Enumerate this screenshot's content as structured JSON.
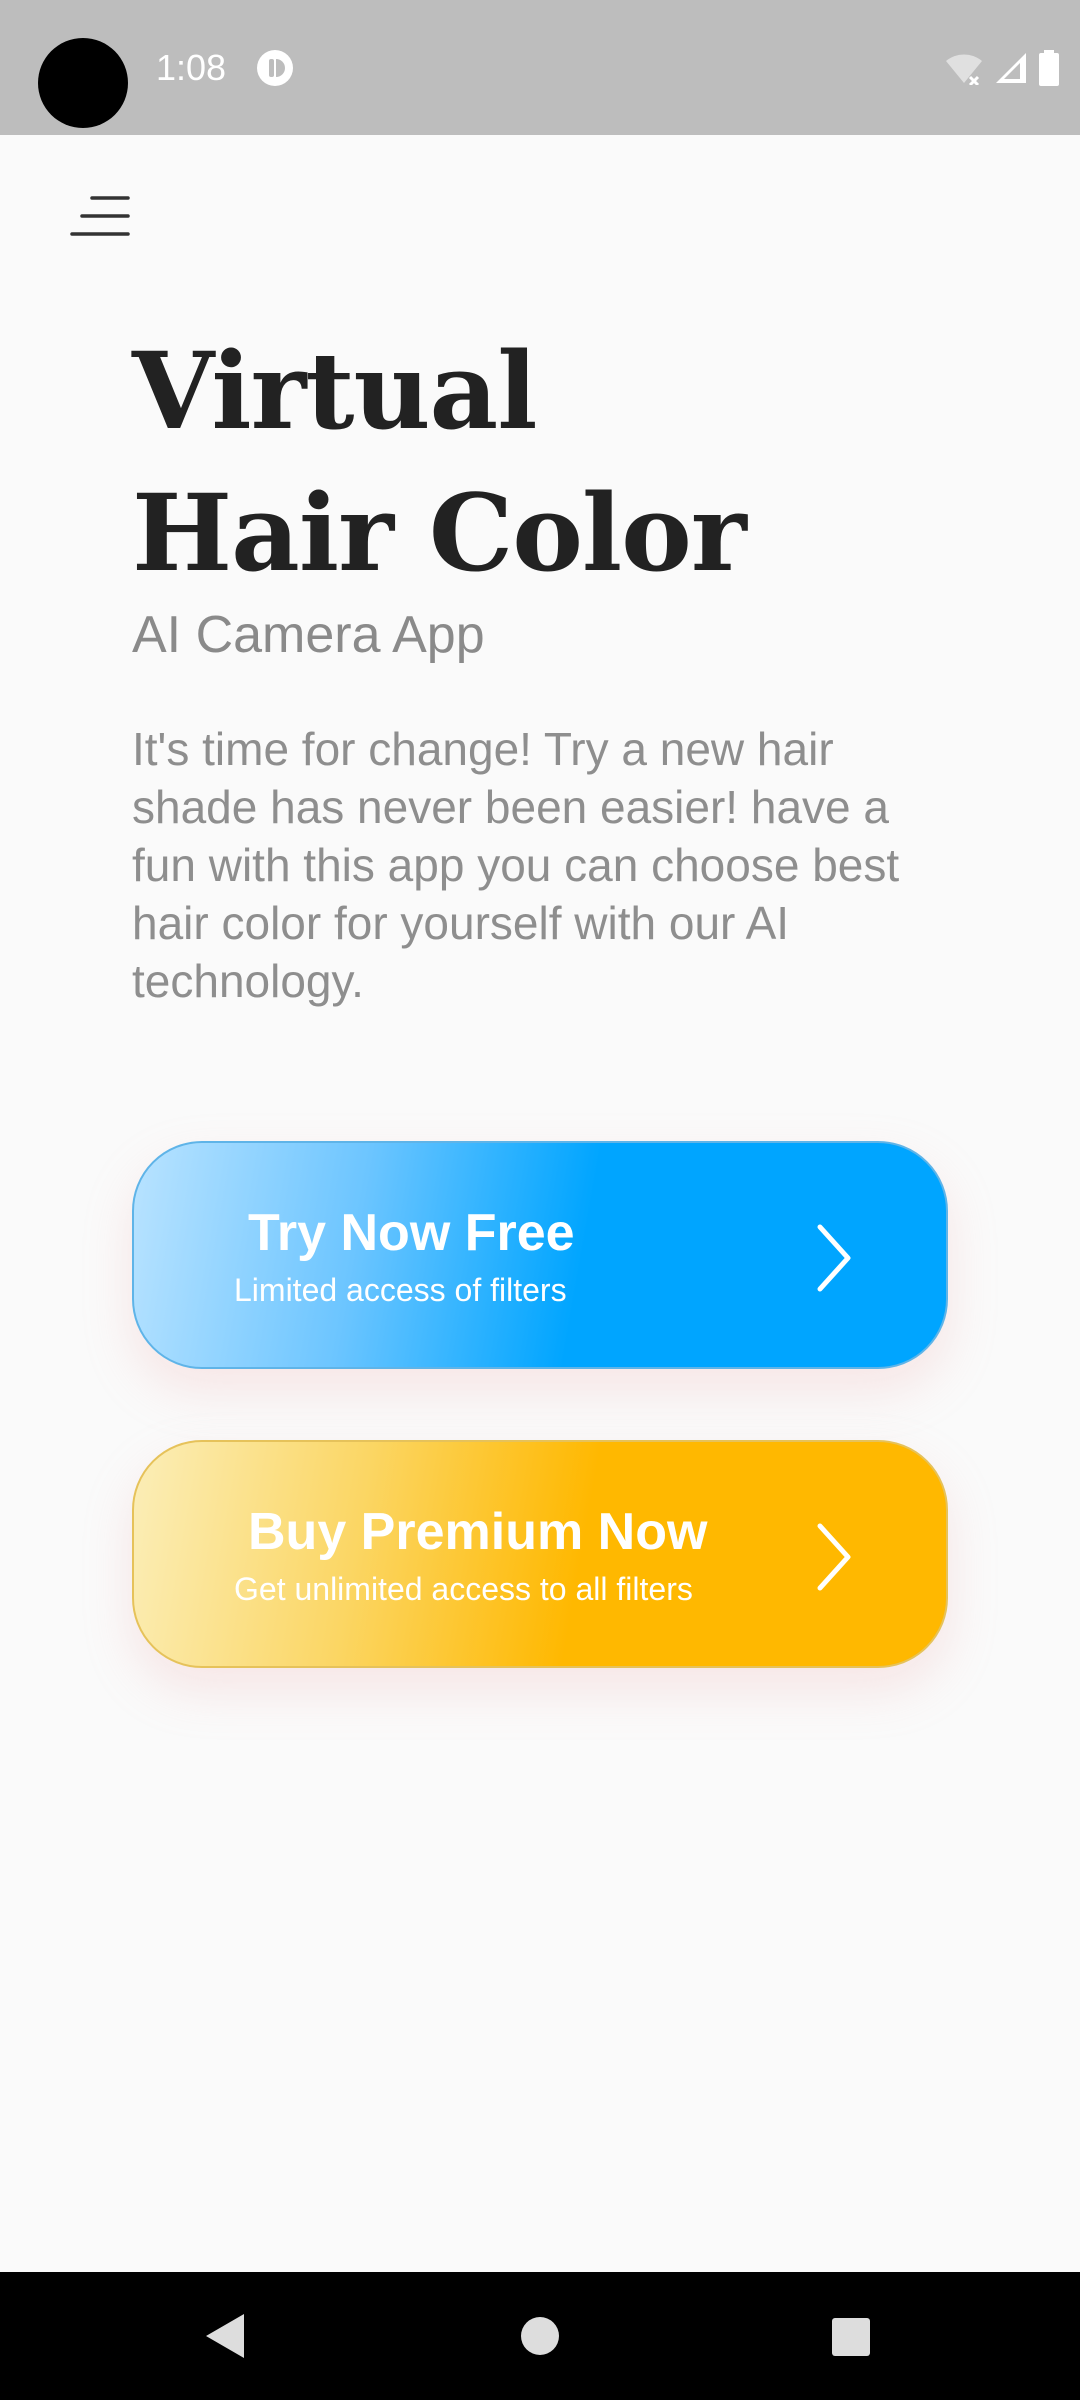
{
  "status_bar": {
    "time": "1:08",
    "icons": [
      "camera-cutout",
      "app-notification-icon",
      "wifi-icon",
      "signal-icon",
      "battery-icon"
    ]
  },
  "header": {
    "menu_icon": "menu-icon"
  },
  "hero": {
    "title_line1": "Virtual",
    "title_line2": "Hair Color",
    "subtitle": "AI Camera App",
    "description": "It's time for change! Try a new hair shade has never been easier! have a fun with this app you can choose best hair color for yourself with our AI technology."
  },
  "cta_free": {
    "title": "Try Now Free",
    "subtitle": "Limited access of filters",
    "icon": "chevron-right-icon",
    "accent": "#00a5ff"
  },
  "cta_premium": {
    "title": "Buy Premium Now",
    "subtitle": "Get unlimited access to all filters",
    "icon": "chevron-right-icon",
    "accent": "#ffb800"
  },
  "nav_bar": {
    "icons": [
      "back-icon",
      "home-icon",
      "recents-icon"
    ]
  }
}
